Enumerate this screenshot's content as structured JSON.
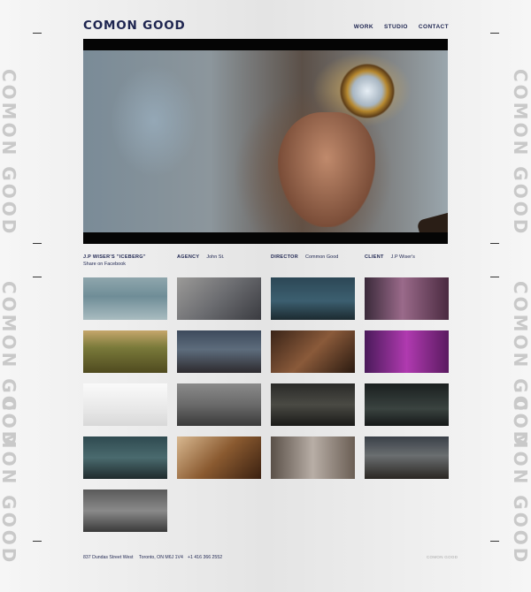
{
  "brand": {
    "logo": "COMON GOOD",
    "side_watermark": "COMON GOOD"
  },
  "nav": {
    "items": [
      "WORK",
      "STUDIO",
      "CONTACT"
    ]
  },
  "project": {
    "title": "J.P WISER'S \"ICEBERG\"",
    "share": "Share on Facebook",
    "agency_label": "AGENCY",
    "agency_value": "John St.",
    "director_label": "DIRECTOR",
    "director_value": "Common Good",
    "client_label": "CLIENT",
    "client_value": "J.P Wiser's"
  },
  "thumbnails": [
    {
      "name": "thumb-iceberg-boat",
      "bg": "linear-gradient(180deg,#8fa6ad 0%,#6f8d97 45%,#a9bcc0 100%)"
    },
    {
      "name": "thumb-statue-man",
      "bg": "linear-gradient(135deg,#9b9a98 0%,#6b6c70 50%,#3a3b40 100%)"
    },
    {
      "name": "thumb-night-street",
      "bg": "linear-gradient(180deg,#2c4755 0%,#3c5f70 55%,#1c2a30 100%)"
    },
    {
      "name": "thumb-sparkler-singer",
      "bg": "linear-gradient(90deg,#3a2a3a 0%,#9a6a8a 45%,#4a2a40 100%)"
    },
    {
      "name": "thumb-vineyard-maze",
      "bg": "linear-gradient(180deg,#c6a66b 0%,#7a7a3a 40%,#4f4a1f 100%)"
    },
    {
      "name": "thumb-cathedral-smoke",
      "bg": "linear-gradient(180deg,#3d4a5c 0%,#5d6c7c 45%,#2d2a2e 100%)"
    },
    {
      "name": "thumb-party-crowd",
      "bg": "linear-gradient(135deg,#3a2418 0%,#8a5a3a 50%,#2a1a10 100%)"
    },
    {
      "name": "thumb-purple-people",
      "bg": "linear-gradient(90deg,#4a1a5a 0%,#b03ab0 50%,#5a1a60 100%)"
    },
    {
      "name": "thumb-hands-statue",
      "bg": "linear-gradient(180deg,#fafafa 0%,#e8e8e8 60%,#d8d8d8 100%)"
    },
    {
      "name": "thumb-blue-car",
      "bg": "linear-gradient(180deg,#8a8a8a 0%,#6a6a6a 50%,#3a3a3a 100%)"
    },
    {
      "name": "thumb-dark-corridor",
      "bg": "linear-gradient(180deg,#2a2a28 0%,#4a4a44 50%,#1a1a18 100%)"
    },
    {
      "name": "thumb-dark-stage",
      "bg": "linear-gradient(180deg,#1a1f1f 0%,#3a4340 60%,#151818 100%)"
    },
    {
      "name": "thumb-weightlifter",
      "bg": "linear-gradient(180deg,#2f4a50 0%,#4a6a6e 50%,#1f2a2c 100%)"
    },
    {
      "name": "thumb-eye-art",
      "bg": "linear-gradient(135deg,#d8b890 0%,#8a5a30 50%,#3a2010 100%)"
    },
    {
      "name": "thumb-nude-room",
      "bg": "linear-gradient(90deg,#5a5048 0%,#b8aea6 50%,#6a5e54 100%)"
    },
    {
      "name": "thumb-dancers",
      "bg": "linear-gradient(180deg,#3a4048 0%,#6a6e70 45%,#2a2622 100%)"
    },
    {
      "name": "thumb-audi-car",
      "bg": "linear-gradient(180deg,#5a5a5a 0%,#8a8a8a 50%,#3a3a3a 100%)"
    }
  ],
  "footer": {
    "address": "837 Dundas Street West",
    "city": "Toronto, ON M6J 1V4",
    "phone": "+1 416 366 2552",
    "copyright": "COMON GOOD"
  }
}
